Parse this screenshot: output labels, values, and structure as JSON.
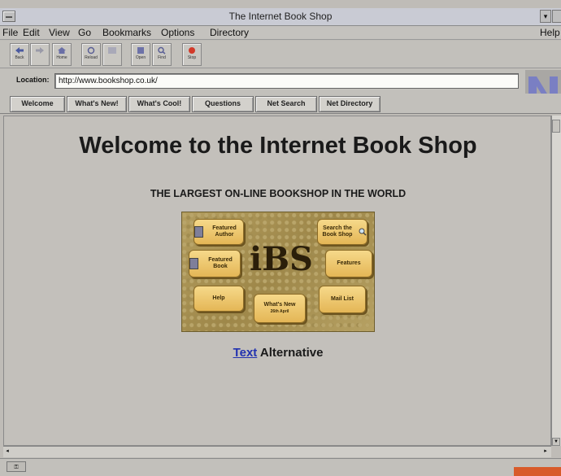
{
  "window": {
    "title": "The Internet Book Shop"
  },
  "menu": {
    "file": "File",
    "edit": "Edit",
    "view": "View",
    "go": "Go",
    "bookmarks": "Bookmarks",
    "options": "Options",
    "directory": "Directory",
    "help": "Help"
  },
  "toolbar": {
    "back": "Back",
    "forward": "",
    "home": "Home",
    "reload": "Reload",
    "images": "",
    "open": "Open",
    "find": "Find",
    "stop": "Stop"
  },
  "location": {
    "label": "Location:",
    "url": "http://www.bookshop.co.uk/"
  },
  "directory_buttons": {
    "welcome": "Welcome",
    "whats_new": "What's New!",
    "whats_cool": "What's Cool!",
    "questions": "Questions",
    "net_search": "Net Search",
    "net_directory": "Net Directory"
  },
  "page": {
    "heading": "Welcome to the Internet Book Shop",
    "subheading": "THE LARGEST ON-LINE BOOKSHOP IN THE WORLD",
    "imagemap": {
      "logo": "iBS",
      "featured_author": "Featured Author",
      "search": "Search the Book Shop",
      "featured_book": "Featured Book",
      "features": "Features",
      "help": "Help",
      "whats_new": "What's New",
      "whats_new_date": "26th April",
      "mail_list": "Mail List"
    },
    "text_alt_link": "Text",
    "text_alt_rest": " Alternative"
  },
  "colors": {
    "link": "#2232b0",
    "progress": "#d85b2a",
    "titlebar": "#c9cbd4"
  }
}
